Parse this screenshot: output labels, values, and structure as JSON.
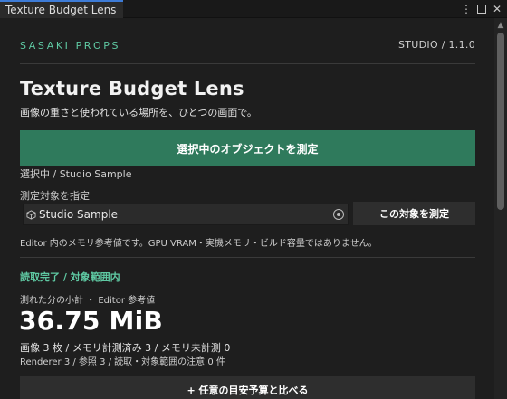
{
  "window": {
    "tab_title": "Texture Budget Lens",
    "more_icon": "vertical-ellipsis-icon",
    "maximize_icon": "maximize-icon",
    "close_icon": "close-icon"
  },
  "header": {
    "brand": "SASAKI PROPS",
    "version": "STUDIO  /  1.1.0"
  },
  "hero": {
    "title": "Texture Budget Lens",
    "subtitle": "画像の重さと使われている場所を、ひとつの画面で。"
  },
  "actions": {
    "measure_selected": "選択中のオブジェクトを測定",
    "selection_info": "選択中  /  Studio Sample"
  },
  "target": {
    "label": "測定対象を指定",
    "object_value": "Studio Sample",
    "object_icon": "cube-icon",
    "picker_icon": "object-picker-icon",
    "measure_target": "この対象を測定",
    "note": "Editor 内のメモリ参考値です。GPU VRAM・実機メモリ・ビルド容量ではありません。"
  },
  "result": {
    "status": "読取完了  /  対象範囲内",
    "subtotal_label": "測れた分の小計  ・  Editor 参考値",
    "total": "36.75 MiB",
    "counts": "画像 3 枚    /    メモリ計測済み 3    /    メモリ未計測 0",
    "details": "Renderer 3    /    参照 3    /    読取・対象範囲の注意 0 件"
  },
  "compare": {
    "label": "+  任意の目安予算と比べる"
  },
  "colors": {
    "accent": "#5fc9a3",
    "primary_button": "#2f7a5c",
    "background": "#1e1e1e"
  }
}
